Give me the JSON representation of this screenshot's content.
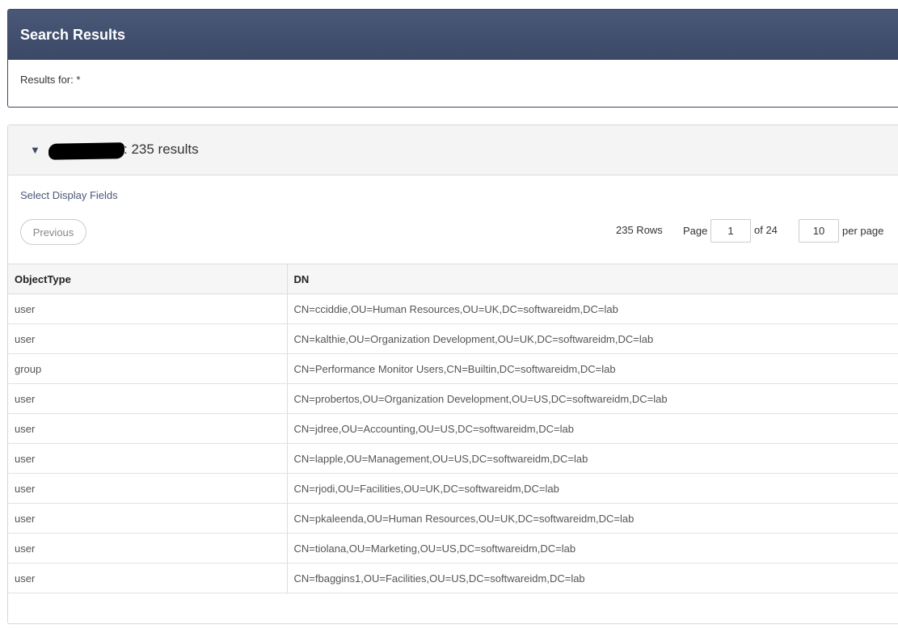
{
  "header": {
    "title": "Search Results",
    "query_text": "Results for: *"
  },
  "group": {
    "title_suffix": ": 235 results",
    "select_fields_label": "Select Display Fields",
    "previous_label": "Previous",
    "rows_count": "235 Rows",
    "page_label": "Page",
    "page_value": "1",
    "of_label": "of 24",
    "per_page_value": "10",
    "per_page_label": "per page"
  },
  "table": {
    "columns": [
      "ObjectType",
      "DN"
    ],
    "rows": [
      {
        "type": "user",
        "dn": "CN=cciddie,OU=Human Resources,OU=UK,DC=softwareidm,DC=lab"
      },
      {
        "type": "user",
        "dn": "CN=kalthie,OU=Organization Development,OU=UK,DC=softwareidm,DC=lab"
      },
      {
        "type": "group",
        "dn": "CN=Performance Monitor Users,CN=Builtin,DC=softwareidm,DC=lab"
      },
      {
        "type": "user",
        "dn": "CN=probertos,OU=Organization Development,OU=US,DC=softwareidm,DC=lab"
      },
      {
        "type": "user",
        "dn": "CN=jdree,OU=Accounting,OU=US,DC=softwareidm,DC=lab"
      },
      {
        "type": "user",
        "dn": "CN=lapple,OU=Management,OU=US,DC=softwareidm,DC=lab"
      },
      {
        "type": "user",
        "dn": "CN=rjodi,OU=Facilities,OU=UK,DC=softwareidm,DC=lab"
      },
      {
        "type": "user",
        "dn": "CN=pkaleenda,OU=Human Resources,OU=UK,DC=softwareidm,DC=lab"
      },
      {
        "type": "user",
        "dn": "CN=tiolana,OU=Marketing,OU=US,DC=softwareidm,DC=lab"
      },
      {
        "type": "user",
        "dn": "CN=fbaggins1,OU=Facilities,OU=US,DC=softwareidm,DC=lab"
      }
    ]
  },
  "colors": {
    "header_bg": "#3d4a63",
    "accent": "#4a5878"
  },
  "icons": {
    "collapse": "caret-down-icon"
  }
}
